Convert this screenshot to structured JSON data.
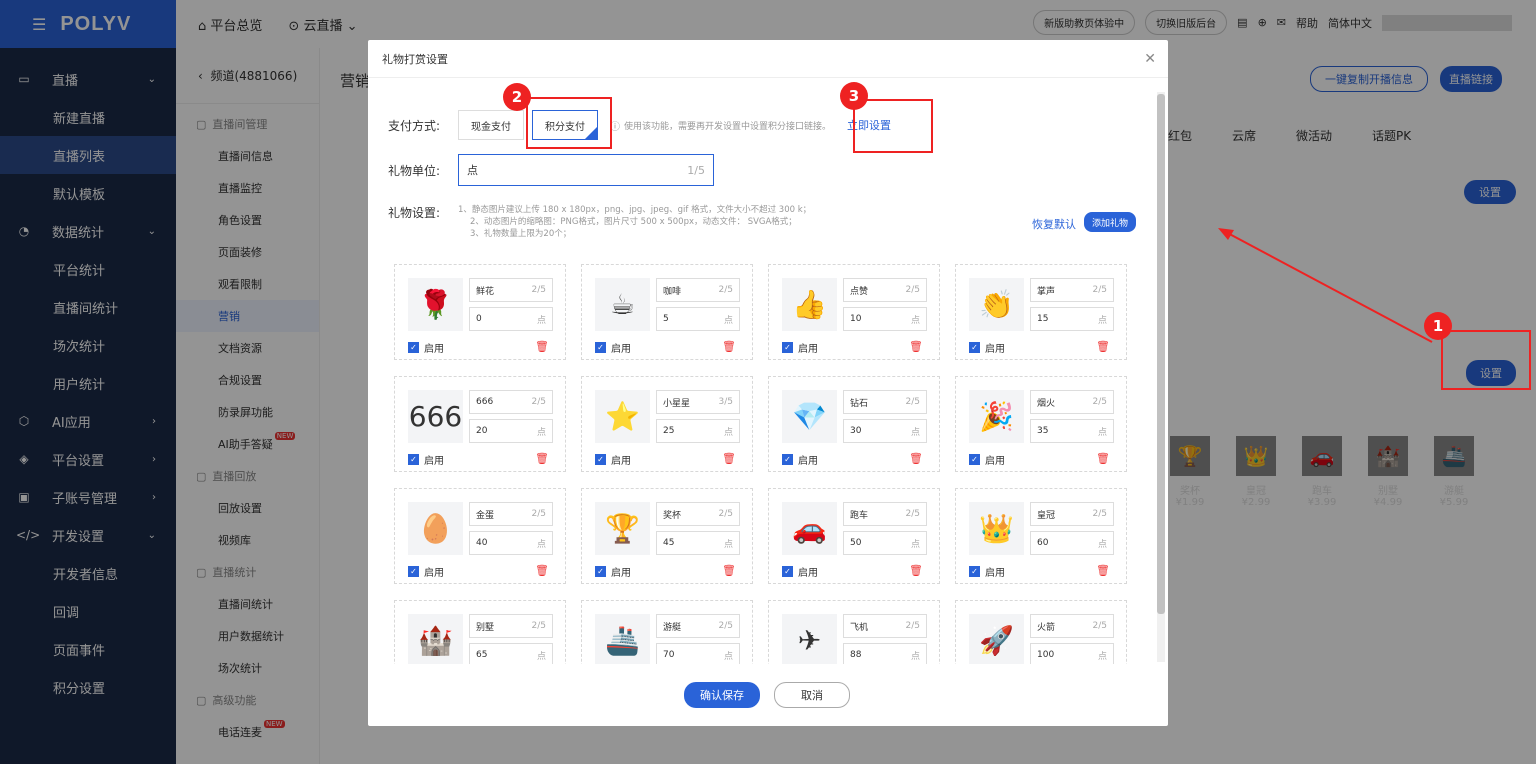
{
  "brand": {
    "name": "POLYV"
  },
  "topbar": {
    "items": [
      "平台总览",
      "云直播"
    ],
    "right": [
      "新版助教页体验中",
      "切换旧版后台",
      "帮助",
      "简体中文"
    ]
  },
  "sidebar": {
    "items": [
      {
        "label": "直播",
        "type": "group"
      },
      {
        "label": "新建直播",
        "type": "sub"
      },
      {
        "label": "直播列表",
        "type": "sub",
        "active": true
      },
      {
        "label": "默认模板",
        "type": "sub"
      },
      {
        "label": "数据统计",
        "type": "group"
      },
      {
        "label": "平台统计",
        "type": "sub"
      },
      {
        "label": "直播间统计",
        "type": "sub"
      },
      {
        "label": "场次统计",
        "type": "sub"
      },
      {
        "label": "用户统计",
        "type": "sub"
      },
      {
        "label": "AI应用",
        "type": "group"
      },
      {
        "label": "平台设置",
        "type": "group"
      },
      {
        "label": "子账号管理",
        "type": "group"
      },
      {
        "label": "开发设置",
        "type": "group"
      },
      {
        "label": "开发者信息",
        "type": "sub"
      },
      {
        "label": "回调",
        "type": "sub"
      },
      {
        "label": "页面事件",
        "type": "sub"
      },
      {
        "label": "积分设置",
        "type": "sub"
      }
    ]
  },
  "subnav": {
    "back": "频道(4881066)",
    "items": [
      {
        "label": "直播间管理",
        "group": true
      },
      {
        "label": "直播间信息"
      },
      {
        "label": "直播监控"
      },
      {
        "label": "角色设置"
      },
      {
        "label": "页面装修"
      },
      {
        "label": "观看限制"
      },
      {
        "label": "营销",
        "active": true
      },
      {
        "label": "文档资源"
      },
      {
        "label": "合规设置"
      },
      {
        "label": "防录屏功能"
      },
      {
        "label": "AI助手答疑"
      },
      {
        "label": "直播回放",
        "group": true
      },
      {
        "label": "回放设置"
      },
      {
        "label": "视频库"
      },
      {
        "label": "直播统计",
        "group": true
      },
      {
        "label": "直播间统计"
      },
      {
        "label": "用户数据统计"
      },
      {
        "label": "场次统计"
      },
      {
        "label": "高级功能",
        "group": true
      },
      {
        "label": "电话连麦"
      }
    ],
    "new_badge": "NEW"
  },
  "main": {
    "title": "营销",
    "copy_btn": "一键复制开播信息",
    "link_btn": "直播链接",
    "tabs": [
      "红包",
      "云席",
      "微活动",
      "话题PK"
    ],
    "set_btn": "设置",
    "bg_gifts": [
      {
        "name": "奖杯",
        "price": "¥1.99"
      },
      {
        "name": "皇冠",
        "price": "¥2.99"
      },
      {
        "name": "跑车",
        "price": "¥3.99"
      },
      {
        "name": "别墅",
        "price": "¥4.99"
      },
      {
        "name": "游艇",
        "price": "¥5.99"
      }
    ]
  },
  "dialog": {
    "title": "礼物打赏设置",
    "pay_label": "支付方式:",
    "pay_cash": "现金支付",
    "pay_points": "积分支付",
    "pay_tip": "使用该功能，需要再开发设置中设置积分接口链接。",
    "setup_link": "立即设置",
    "unit_label": "礼物单位:",
    "unit_value": "点",
    "unit_count": "1/5",
    "gift_label": "礼物设置:",
    "gift_tip1": "1、静态图片建议上传 180 x 180px，png、jpg、jpeg、gif 格式，文件大小不超过 300 k；",
    "gift_tip2": "2、动态图片的缩略图：PNG格式，图片尺寸 500 x 500px，动态文件： SVGA格式；",
    "gift_tip3": "3、礼物数量上限为20个；",
    "restore": "恢复默认",
    "add_gift": "添加礼物",
    "enable": "启用",
    "unit": "点",
    "save": "确认保存",
    "cancel": "取消",
    "gifts": [
      {
        "name": "鲜花",
        "count": "2/5",
        "value": "0",
        "icon": "🌹"
      },
      {
        "name": "咖啡",
        "count": "2/5",
        "value": "5",
        "icon": "☕"
      },
      {
        "name": "点赞",
        "count": "2/5",
        "value": "10",
        "icon": "👍"
      },
      {
        "name": "掌声",
        "count": "2/5",
        "value": "15",
        "icon": "👏"
      },
      {
        "name": "666",
        "count": "2/5",
        "value": "20",
        "icon": "666"
      },
      {
        "name": "小星星",
        "count": "3/5",
        "value": "25",
        "icon": "⭐"
      },
      {
        "name": "钻石",
        "count": "2/5",
        "value": "30",
        "icon": "💎"
      },
      {
        "name": "烟火",
        "count": "2/5",
        "value": "35",
        "icon": "🎉"
      },
      {
        "name": "金蛋",
        "count": "2/5",
        "value": "40",
        "icon": "🥚"
      },
      {
        "name": "奖杯",
        "count": "2/5",
        "value": "45",
        "icon": "🏆"
      },
      {
        "name": "跑车",
        "count": "2/5",
        "value": "50",
        "icon": "🚗"
      },
      {
        "name": "皇冠",
        "count": "2/5",
        "value": "60",
        "icon": "👑"
      },
      {
        "name": "别墅",
        "count": "2/5",
        "value": "65",
        "icon": "🏰"
      },
      {
        "name": "游艇",
        "count": "2/5",
        "value": "70",
        "icon": "🚢"
      },
      {
        "name": "飞机",
        "count": "2/5",
        "value": "88",
        "icon": "✈"
      },
      {
        "name": "火箭",
        "count": "2/5",
        "value": "100",
        "icon": "🚀"
      }
    ]
  },
  "annotations": [
    "1",
    "2",
    "3"
  ],
  "colors": {
    "accent": "#2a63d8",
    "sidebar": "#1b2a47",
    "highlight": "#e22222"
  }
}
